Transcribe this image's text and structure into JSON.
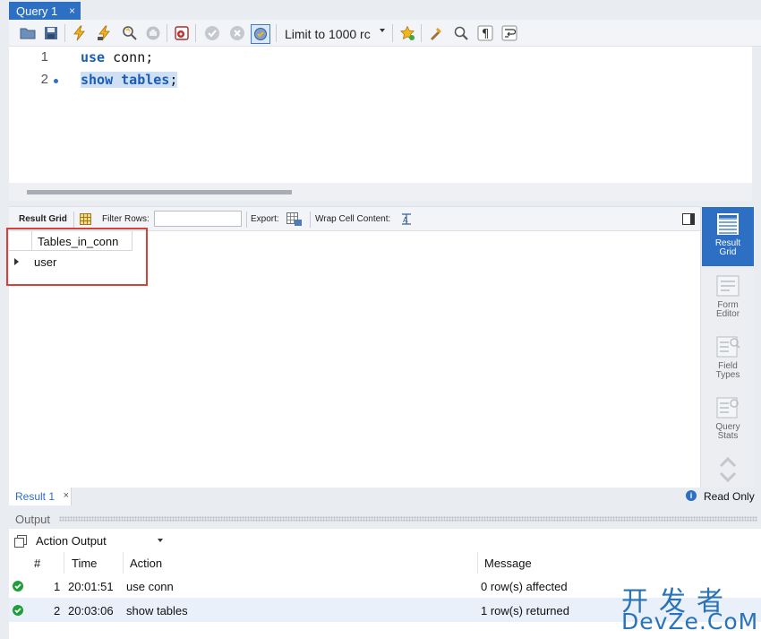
{
  "tab": {
    "title": "Query 1",
    "close": "×"
  },
  "toolbar": {
    "limit_label": "Limit to 1000 rc",
    "icons": [
      "open-folder-icon",
      "save-icon",
      "execute-icon",
      "execute-current-icon",
      "explain-icon",
      "stop-icon",
      "toggle-continue-icon",
      "commit-icon",
      "rollback-icon",
      "autocommit-icon",
      "star-icon",
      "beautify-icon",
      "find-icon",
      "invisible-chars-icon",
      "wrap-icon"
    ]
  },
  "editor": {
    "lines": [
      {
        "num": "1",
        "kw": "use",
        "rest": " conn;"
      },
      {
        "num": "2",
        "kw": "show",
        "mid": " ",
        "kw2": "tables",
        "rest": ";"
      }
    ]
  },
  "result_toolbar": {
    "result_grid": "Result Grid",
    "filter_rows": "Filter Rows:",
    "export": "Export:",
    "wrap": "Wrap Cell Content:"
  },
  "grid": {
    "column": "Tables_in_conn",
    "rows": [
      "user"
    ]
  },
  "side_panel": {
    "result_grid": [
      "Result",
      "Grid"
    ],
    "form_editor": [
      "Form",
      "Editor"
    ],
    "field_types": [
      "Field",
      "Types"
    ],
    "query_stats": [
      "Query",
      "Stats"
    ]
  },
  "status": {
    "result_tab": "Result 1",
    "close": "×",
    "readonly": "Read Only"
  },
  "output": {
    "title": "Output",
    "selector": "Action Output",
    "headers": {
      "num": "#",
      "time": "Time",
      "action": "Action",
      "message": "Message"
    },
    "rows": [
      {
        "num": "1",
        "time": "20:01:51",
        "action": "use conn",
        "message": "0 row(s) affected"
      },
      {
        "num": "2",
        "time": "20:03:06",
        "action": "show tables",
        "message": "1 row(s) returned"
      }
    ]
  },
  "watermark": {
    "cn": "开发者",
    "en": "DevZe.CoM"
  }
}
